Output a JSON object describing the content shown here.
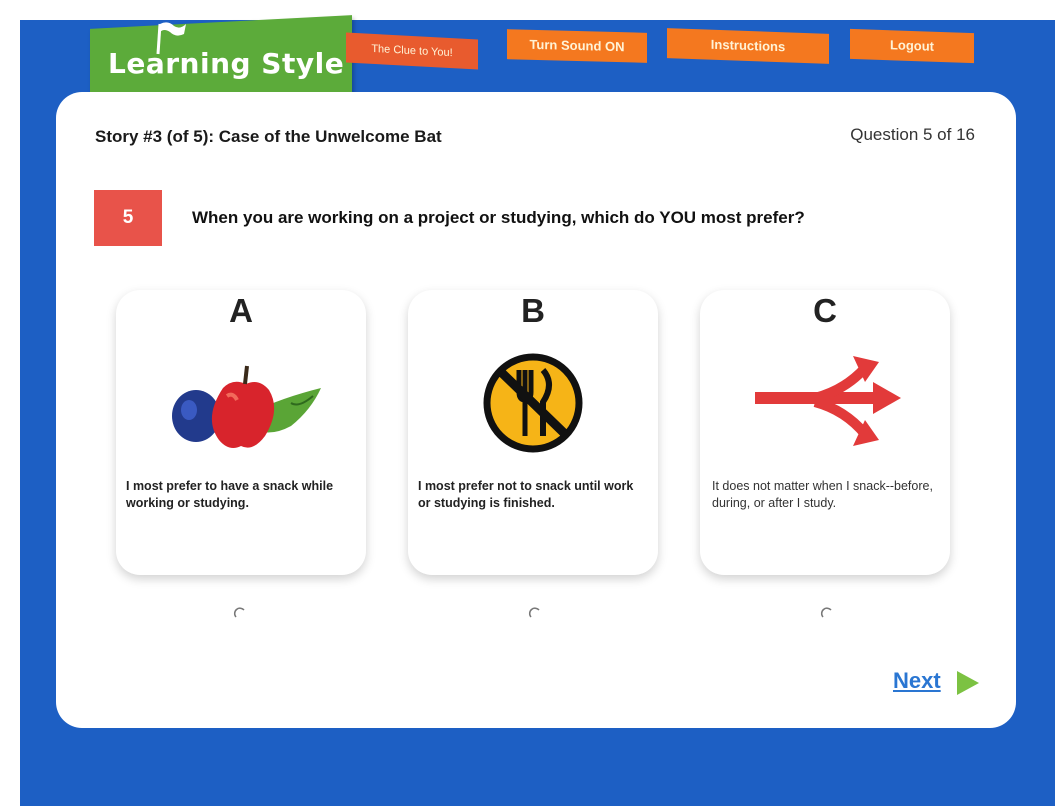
{
  "header": {
    "logo_text": "Learning Style",
    "tagline": "The Clue to You!",
    "nav": {
      "sound_label": "Turn Sound ON",
      "instructions_label": "Instructions",
      "logout_label": "Logout"
    }
  },
  "story": {
    "title": "Story #3 (of 5): Case of the Unwelcome Bat",
    "question_counter": "Question 5 of 16"
  },
  "question": {
    "number": "5",
    "text": "When you are working on a project or studying, which do YOU most prefer?"
  },
  "options": [
    {
      "letter": "A",
      "icon": "fruit-snack-icon",
      "text": "I most prefer to have a snack while working or studying.",
      "selected": false
    },
    {
      "letter": "B",
      "icon": "no-eating-icon",
      "text": "I most prefer not to snack until work or studying is finished.",
      "selected": false
    },
    {
      "letter": "C",
      "icon": "branching-arrow-icon",
      "text": "It does not matter when I snack--before, during, or after I study.",
      "selected": false
    }
  ],
  "footer": {
    "next_label": "Next"
  },
  "colors": {
    "background_blue": "#1d5fc4",
    "logo_green": "#5cab3a",
    "nav_orange": "#f4781f",
    "badge_red": "#e8534a",
    "link_blue": "#2a76d2",
    "next_arrow_green": "#7cc242"
  }
}
